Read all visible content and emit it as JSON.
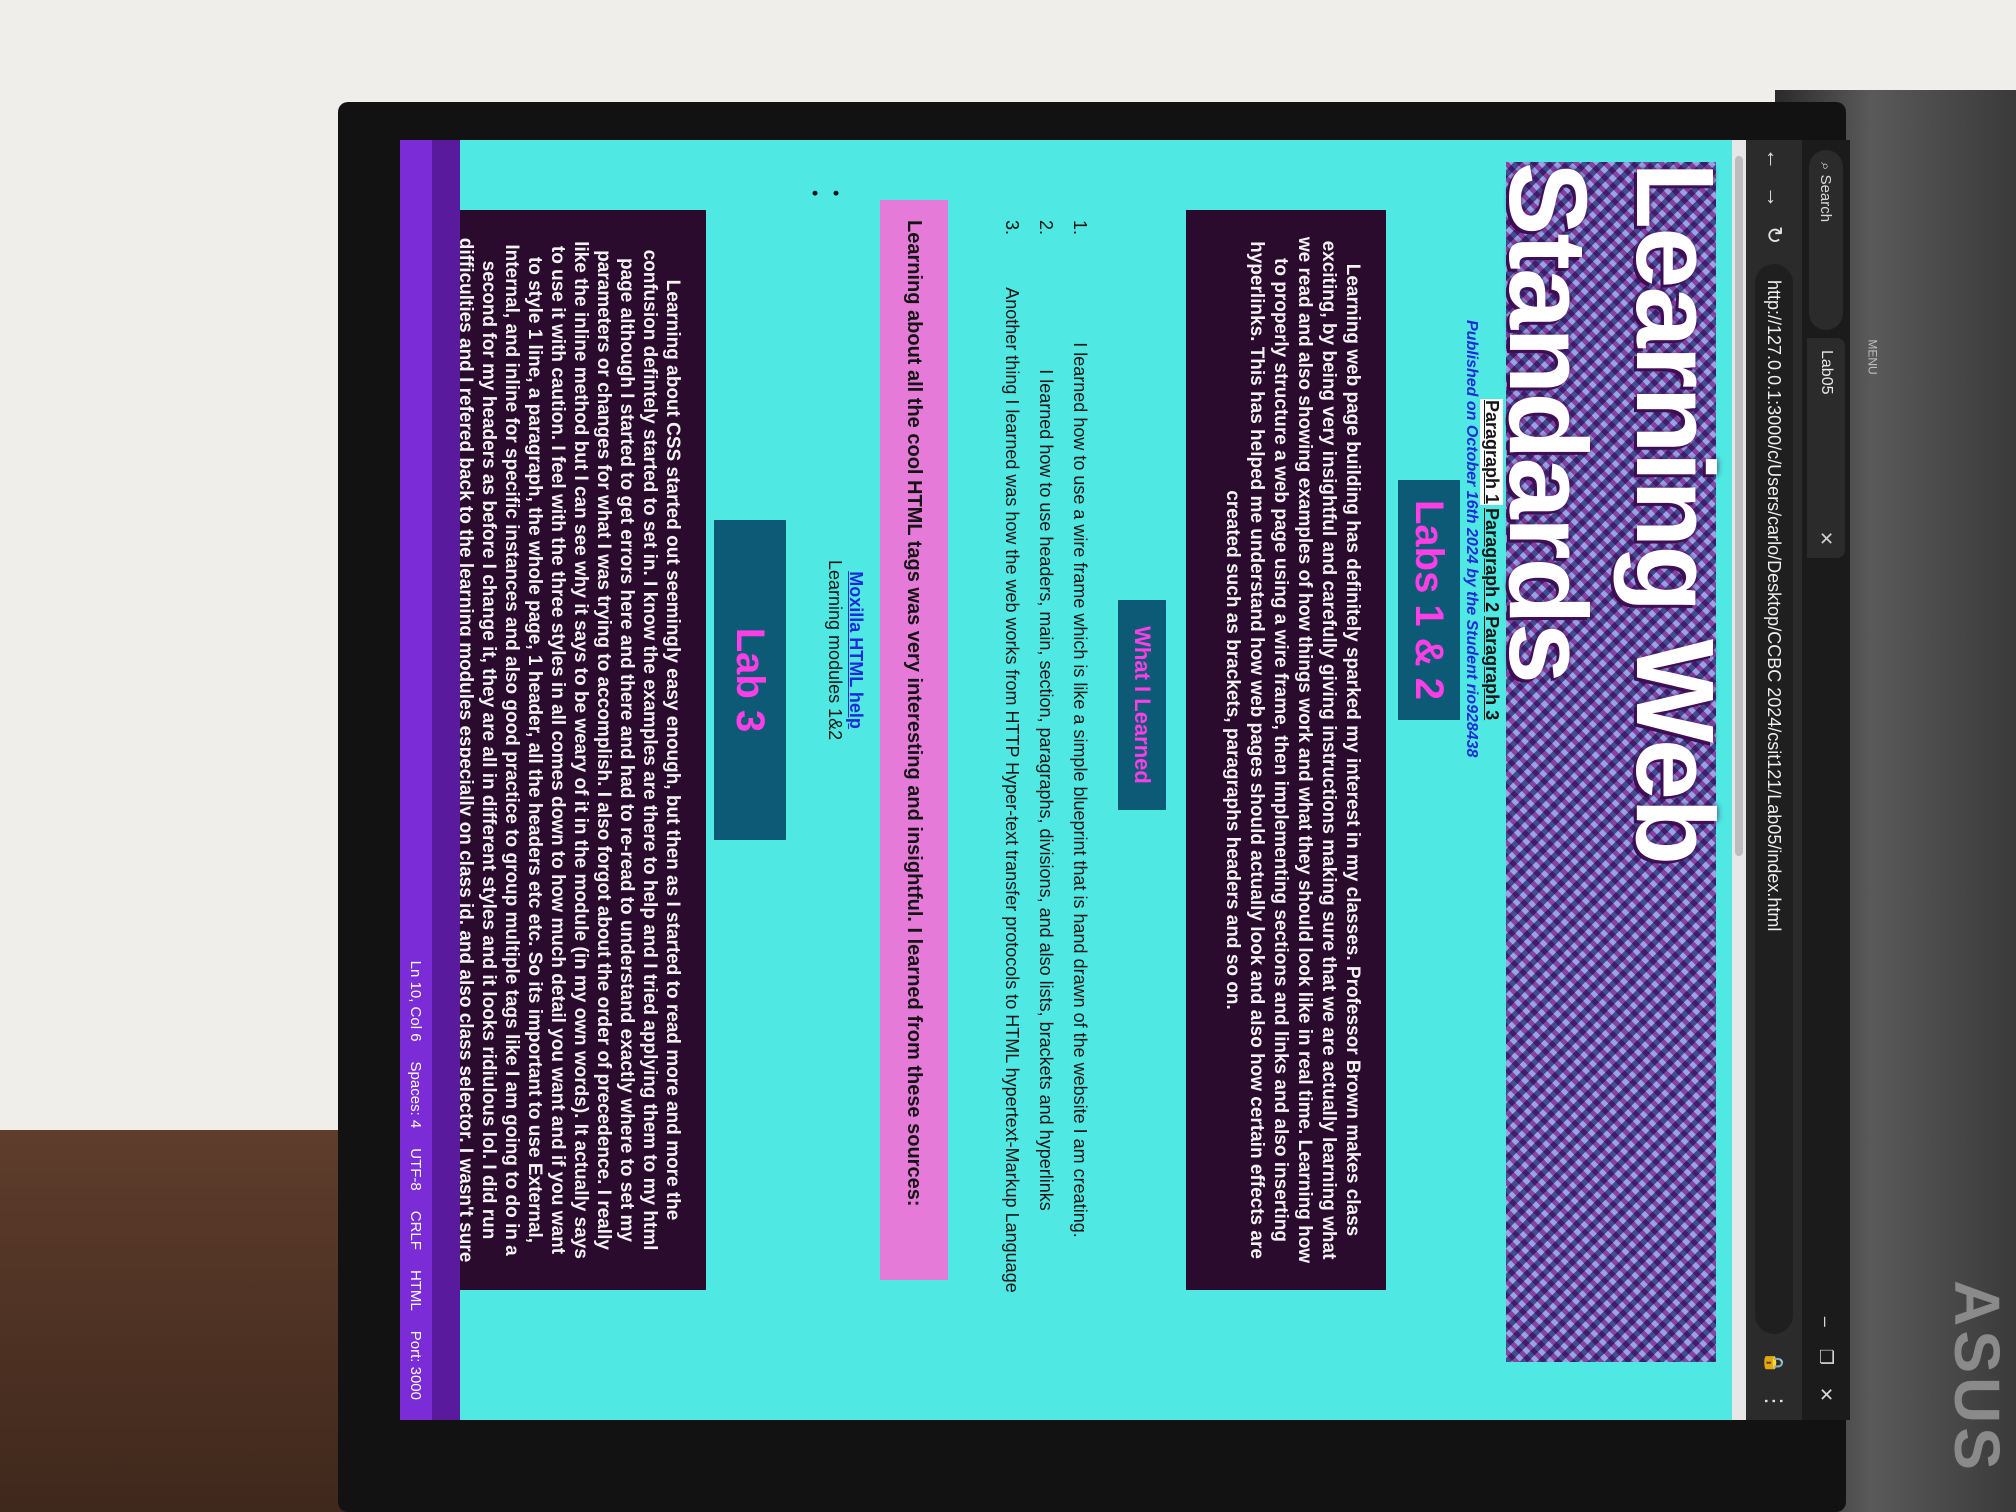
{
  "browser": {
    "search_label": "Search",
    "tab_title": "Lab05",
    "url": "http://127.0.0.1:3000/c/Users/carlo/Desktop/CCBC 2024/csit121/Lab05/index.html"
  },
  "page": {
    "title": "Learning Web Standards",
    "para_links": [
      "Paragraph 1",
      "Paragraph 2",
      "Paragraph 3"
    ],
    "published": "Published on October 16th 2024 by the Student rio928438",
    "labs12_heading": "Labs 1 & 2",
    "labs12_text": "Learning web page building has definitely sparked my interest in my classes. Professor Brown makes class exciting, by being very insightful and carefully giving instructions making sure that we are actually learning what we read and also showing examples of how things work and what they should look like in real time. Learning how to properly structure a web page using a wire frame, then implementing sections and links and also inserting hyperlinks. This has helped me understand how web pages should actually look and also how certain effects are created such as brackets, paragraphs headers and so on.",
    "learned_heading": "What I Learned",
    "learned_items": [
      "I learned how to use a wire frame which is like a simple blueprint that is hand drawn of the website I am creating.",
      "I learned how to use headers, main, section, paragraphs, divisions, and also lists, brackets and hyperlinks",
      "Another thing I learned was how the web works from HTTP Hyper-text transfer protocols to HTML hypertext-Markup Language"
    ],
    "sources_intro": "Learning about all the cool HTML tags was very interesting and insightful. I learned from these sources:",
    "source_link": "Moxilla HTML help",
    "source_text": "Learning modules 1&2",
    "lab3_heading": "Lab 3",
    "lab3_text": "Learning about CSS started out seemingly easy enough, but then as I started to read more and more the confusion defintely started to set in. I know the examples are there to help and I tried applying them to my html page although I started to get errors here and there and had to re-read to understand exactly where to set my parameters or changes for what I was trying to accomplish. I also forgot about the order of precedence. I really like the inline method but I can see why it says to be weary of it in the module (in my own words). It actually says to use it with caution. I feel with the three styles in all comes down to how much detail you want and if you want to style 1 line, a paragraph, the whole page, 1 header, all the headers etc etc. So its important to use External, Internal, and inline for specific instances and also good practice to group multiple tags like I am going to do in a second for my headers as before I change it, they are all in different styles and it looks ridiulous lol. I did run difficulties and I refered back to the learning modules especially on class id, and also class selector. I wasn't sure how to id the id lol, and id the classes specifically I wanted to change."
  },
  "statusbar": {
    "items": [
      "Ln 10, Col 6",
      "Spaces: 4",
      "UTF-8",
      "CRLF",
      "HTML",
      "Port: 3000"
    ]
  },
  "monitor": {
    "brand": "ASUS",
    "menu_label": "MENU"
  }
}
